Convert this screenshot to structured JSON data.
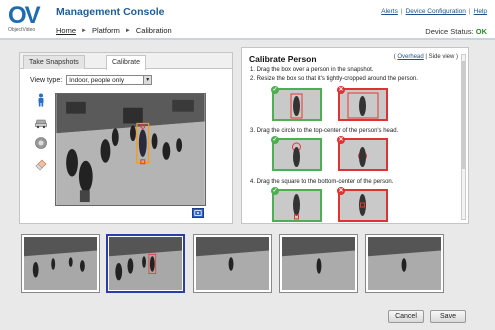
{
  "brand": {
    "logo_mark": "OV",
    "logo_text": "ObjectVideo"
  },
  "app": {
    "title": "Management Console"
  },
  "breadcrumb": {
    "home": "Home",
    "platform": "Platform",
    "calibration": "Calibration"
  },
  "top_links": {
    "alerts": "Alerts",
    "device_configuration": "Device Configuration",
    "help": "Help"
  },
  "device_status": {
    "label": "Device Status:",
    "value": "OK"
  },
  "tabs": {
    "snapshots": "Take Snapshots",
    "calibrate": "Calibrate"
  },
  "view_type": {
    "label": "View type:",
    "value": "Indoor, people only"
  },
  "calibrate_person": {
    "title": "Calibrate Person",
    "overhead_link": "Overhead",
    "side_view": "Side view",
    "steps": [
      "1.  Drag the box over a person in the snapshot.",
      "2.  Resize the box so that it's tightly-cropped around the person.",
      "3.  Drag the circle to the top-center of the person's head.",
      "4.  Drag the square to the bottom-center of the person."
    ]
  },
  "buttons": {
    "cancel": "Cancel",
    "save": "Save"
  },
  "icons": {
    "person": "person-icon",
    "car": "car-icon",
    "wheel": "wheel-icon",
    "eraser": "eraser-icon",
    "screen_tool": "screen-tool-icon"
  },
  "colors": {
    "accent": "#1f5d95",
    "ok": "#2a8a2a",
    "good": "#4caf50",
    "bad": "#d33333",
    "selected": "#2b3da8"
  }
}
